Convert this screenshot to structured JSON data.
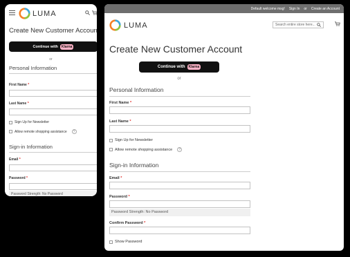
{
  "brand": {
    "name": "LUMA"
  },
  "topbar": {
    "welcome": "Default welcome msg!",
    "sign_in": "Sign In",
    "or": "or",
    "create_account": "Create an Account"
  },
  "search": {
    "placeholder": "Search entire store here..."
  },
  "page": {
    "title": "Create New Customer Account",
    "klarna_button_prefix": "Continue with",
    "klarna_brand": "Klarna",
    "or_divider": "or"
  },
  "personal": {
    "heading": "Personal Information",
    "first_name_label": "First Name",
    "last_name_label": "Last Name",
    "required_mark": "*",
    "newsletter_label": "Sign Up for Newsletter",
    "remote_assist_label": "Allow remote shopping assistance",
    "help_glyph": "?"
  },
  "signin": {
    "heading": "Sign-in Information",
    "email_label": "Email",
    "password_label": "Password",
    "password_strength": "Password Strength: No Password",
    "confirm_password_label": "Confirm Password",
    "show_password_label": "Show Password"
  },
  "icons": {
    "menu": "hamburger-icon",
    "search": "search-icon",
    "cart": "cart-icon",
    "logo": "luma-logo-icon"
  },
  "colors": {
    "accent_required": "#e02b27",
    "klarna_pink": "#ffb3c7",
    "topbar_bg": "#6e6e6e"
  }
}
